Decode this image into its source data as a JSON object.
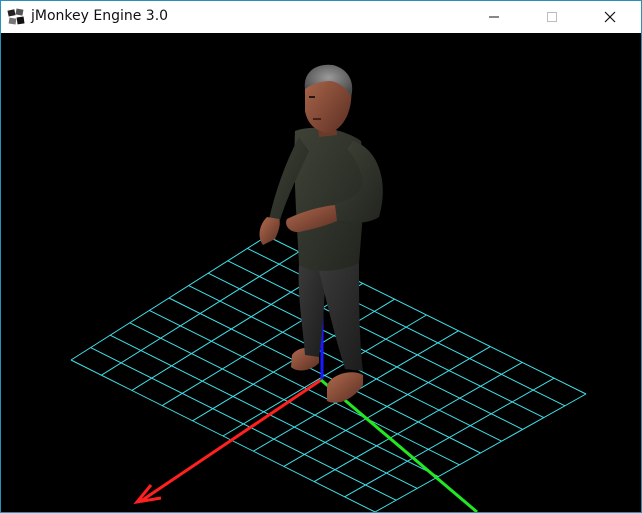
{
  "window": {
    "title": "jMonkey Engine 3.0",
    "icon": "jmonkey-logo-icon",
    "buttons": {
      "minimize": "minimize-icon",
      "maximize": "maximize-icon",
      "close": "close-icon"
    }
  },
  "scene": {
    "background": "#000000",
    "grid_color": "#40e0e8",
    "axis_colors": {
      "x": "#ff2020",
      "y": "#1a1aff",
      "z": "#22e822"
    }
  }
}
